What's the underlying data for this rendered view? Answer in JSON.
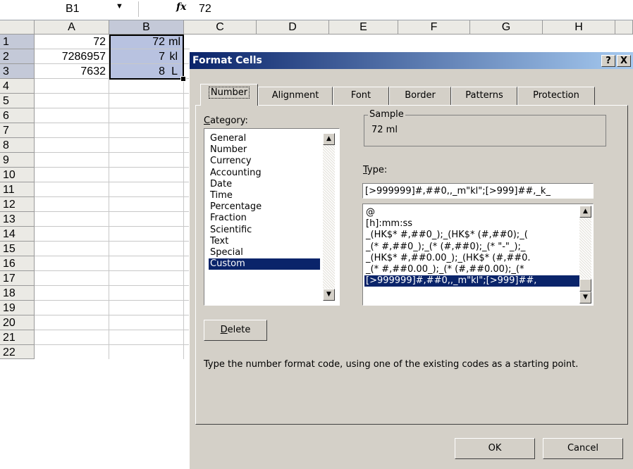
{
  "formula_bar": {
    "name_box": "B1",
    "fx": "fx",
    "formula": "72"
  },
  "sheet": {
    "columns": [
      "A",
      "B",
      "C",
      "D",
      "E",
      "F",
      "G",
      "H"
    ],
    "rows": [
      "1",
      "2",
      "3",
      "4",
      "5",
      "6",
      "7",
      "8",
      "9",
      "10",
      "11",
      "12",
      "13",
      "14",
      "15",
      "16",
      "17",
      "18",
      "19",
      "20",
      "21",
      "22"
    ],
    "cells": [
      {
        "a": "72",
        "b_num": "72",
        "b_unit": "ml"
      },
      {
        "a": "7286957",
        "b_num": "7",
        "b_unit": "kl"
      },
      {
        "a": "7632",
        "b_num": "8",
        "b_unit": "L"
      }
    ]
  },
  "dialog": {
    "title": "Format Cells",
    "help_label": "?",
    "close_label": "X",
    "tabs": [
      "Number",
      "Alignment",
      "Font",
      "Border",
      "Patterns",
      "Protection"
    ],
    "category_label_pre": "",
    "category_label_u": "C",
    "category_label_post": "ategory:",
    "categories": [
      "General",
      "Number",
      "Currency",
      "Accounting",
      "Date",
      "Time",
      "Percentage",
      "Fraction",
      "Scientific",
      "Text",
      "Special",
      "Custom"
    ],
    "selected_category": "Custom",
    "sample_label": "Sample",
    "sample_value": "72 ml",
    "type_label_u": "T",
    "type_label_post": "ype:",
    "type_value": "[>999999]#,##0,,_m\"kl\";[>999]##,_k_",
    "type_list": [
      "@",
      "[h]:mm:ss",
      "_(HK$* #,##0_);_(HK$* (#,##0);_(",
      "_(* #,##0_);_(* (#,##0);_(* \"-\"_);_",
      "_(HK$* #,##0.00_);_(HK$* (#,##0.",
      "_(* #,##0.00_);_(* (#,##0.00);_(*",
      "[>999999]#,##0,,_m\"kl\";[>999]##,"
    ],
    "delete_label_u": "D",
    "delete_label_post": "elete",
    "hint": "Type the number format code, using one of the existing codes as a starting point.",
    "ok_label": "OK",
    "cancel_label": "Cancel"
  },
  "colors": {
    "title_start": "#0a246a",
    "title_end": "#a6caf0",
    "selection": "#b8c2e0",
    "dialog_bg": "#d4d0c8"
  }
}
